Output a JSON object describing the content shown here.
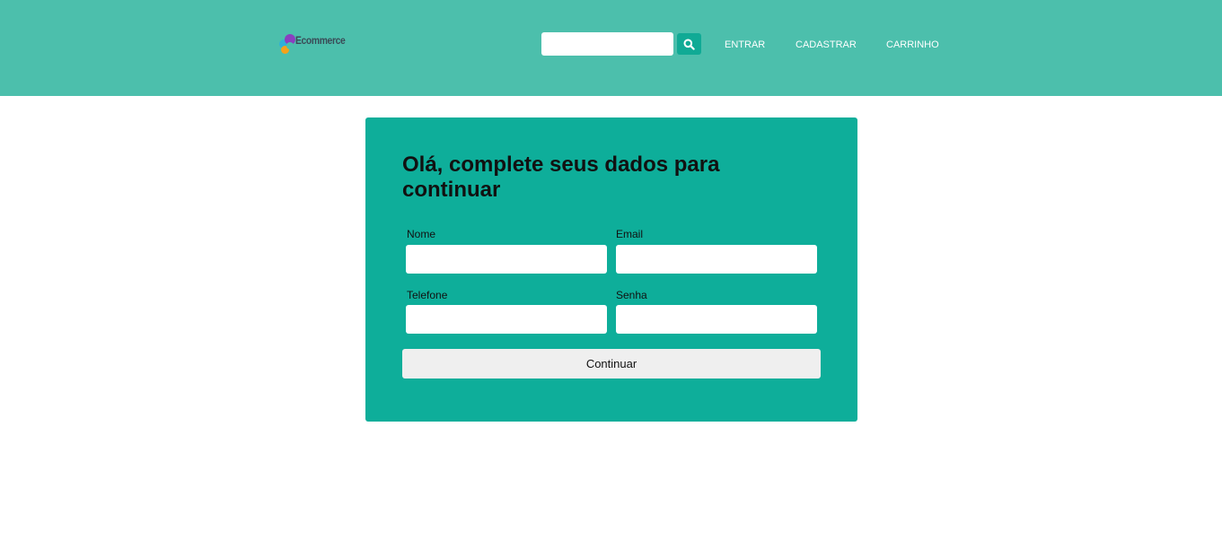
{
  "header": {
    "logo_text": "Ecommerce",
    "search": {
      "value": "",
      "placeholder": ""
    },
    "nav": {
      "login": "ENTRAR",
      "register": "CADASTRAR",
      "cart": "CARRINHO"
    },
    "icons": {
      "search": "search-icon",
      "logo": "logo-icon"
    }
  },
  "form": {
    "title": "Olá, complete seus dados para continuar",
    "fields": {
      "name": {
        "label": "Nome",
        "value": ""
      },
      "email": {
        "label": "Email",
        "value": ""
      },
      "phone": {
        "label": "Telefone",
        "value": ""
      },
      "password": {
        "label": "Senha",
        "value": ""
      }
    },
    "submit_label": "Continuar"
  },
  "colors": {
    "header_bg": "#4cbfac",
    "card_bg": "#0eae9a",
    "search_button_bg": "#10aa95",
    "button_bg": "#efefef"
  }
}
